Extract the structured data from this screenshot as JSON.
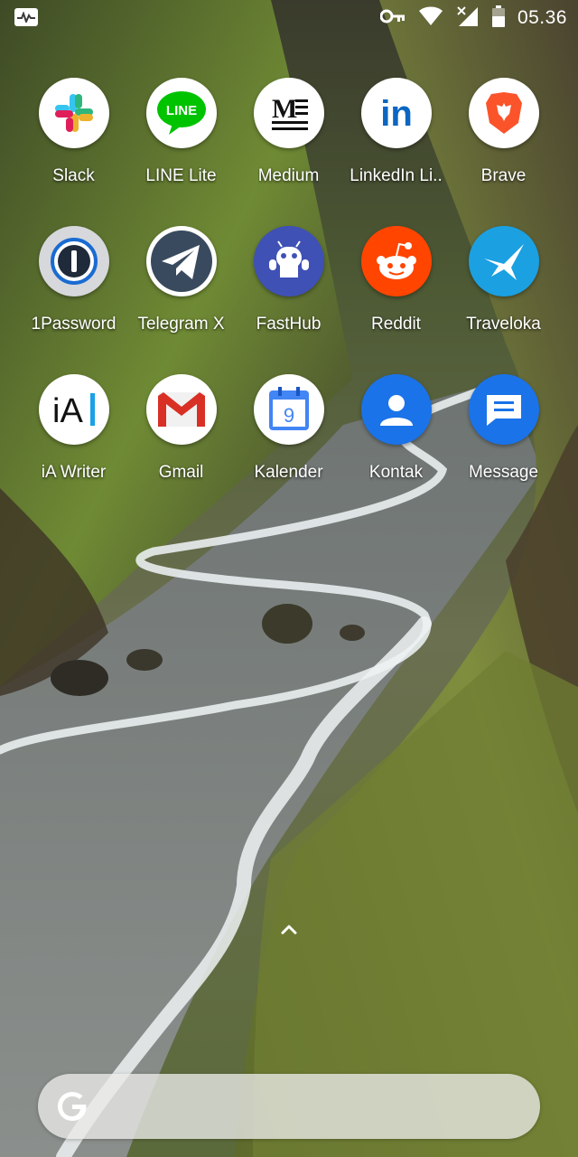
{
  "status_bar": {
    "time": "05.36",
    "icons": [
      "activity-monitor-icon",
      "vpn-key-icon",
      "wifi-icon",
      "cell-signal-icon",
      "battery-icon"
    ]
  },
  "apps": [
    {
      "label": "Slack",
      "icon": "slack-icon"
    },
    {
      "label": "LINE Lite",
      "icon": "line-icon"
    },
    {
      "label": "Medium",
      "icon": "medium-icon"
    },
    {
      "label": "LinkedIn Li..",
      "icon": "linkedin-icon"
    },
    {
      "label": "Brave",
      "icon": "brave-icon"
    },
    {
      "label": "1Password",
      "icon": "1password-icon"
    },
    {
      "label": "Telegram X",
      "icon": "telegram-icon"
    },
    {
      "label": "FastHub",
      "icon": "fasthub-icon"
    },
    {
      "label": "Reddit",
      "icon": "reddit-icon"
    },
    {
      "label": "Traveloka",
      "icon": "traveloka-icon"
    },
    {
      "label": "iA Writer",
      "icon": "ia-writer-icon"
    },
    {
      "label": "Gmail",
      "icon": "gmail-icon"
    },
    {
      "label": "Kalender",
      "icon": "calendar-icon",
      "calendar_day": "9"
    },
    {
      "label": "Kontak",
      "icon": "contacts-icon"
    },
    {
      "label": "Message",
      "icon": "messages-icon"
    }
  ],
  "icon_text": {
    "line": "LINE",
    "medium": "M",
    "linkedin": "in",
    "ia_writer": "iA"
  },
  "search": {
    "icon": "google-g-icon"
  },
  "drawer": {
    "icon": "chevron-up-icon"
  },
  "colors": {
    "slack": "#ffffff",
    "line": "#00c300",
    "linkedin": "#0a66c2",
    "brave": "#fb542b",
    "fasthub": "#3f51b5",
    "reddit": "#ff4500",
    "traveloka": "#1ba0e2",
    "kontak": "#1a73e8",
    "message": "#1a73e8",
    "gmail_red": "#d93025",
    "calendar_blue": "#4285f4"
  }
}
